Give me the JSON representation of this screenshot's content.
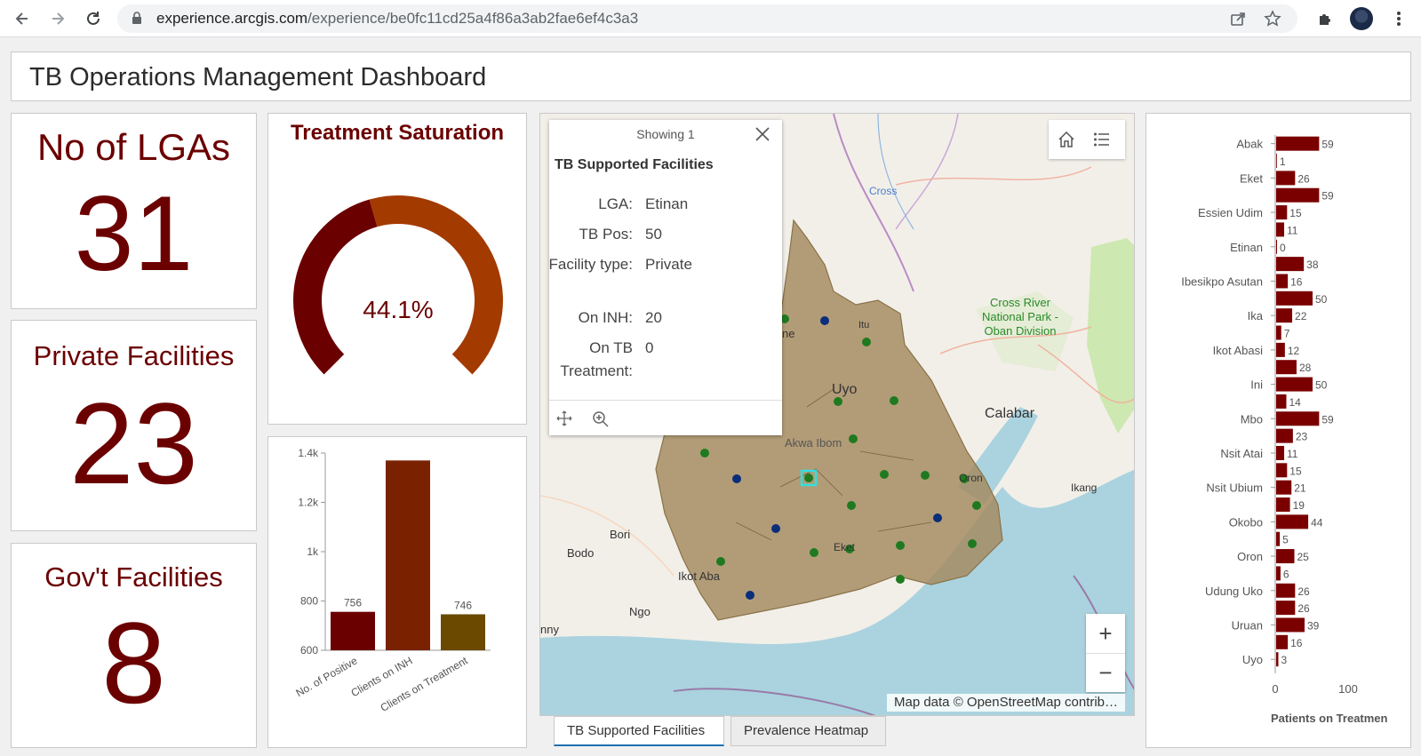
{
  "browser": {
    "url_host": "experience.arcgis.com",
    "url_path": "/experience/be0fc11cd25a4f86a3ab2fae6ef4c3a3"
  },
  "dashboard": {
    "title": "TB Operations Management Dashboard"
  },
  "indicators": [
    {
      "title": "No of LGAs",
      "value": "31"
    },
    {
      "title": "Private Facilities",
      "value": "23"
    },
    {
      "title": "Gov't Facilities",
      "value": "8"
    }
  ],
  "gauge": {
    "title": "Treatment Saturation",
    "value_text": "44.1%",
    "fraction": 0.441,
    "colors": {
      "filled": "#6b0000",
      "remaining": "#a33a00"
    }
  },
  "map": {
    "popup": {
      "header": "Showing 1",
      "title": "TB Supported Facilities",
      "rows": [
        {
          "key": "LGA:",
          "value": "Etinan"
        },
        {
          "key": "TB Pos:",
          "value": "50"
        },
        {
          "key": "Facility type:",
          "value": "Private"
        },
        {
          "key": "On INH:",
          "value": "20"
        },
        {
          "key": "On TB Treatment:",
          "value": "0"
        }
      ]
    },
    "labels": {
      "cross": "Cross",
      "park": "Cross River National Park - Oban Division",
      "uyo": "Uyo",
      "calabar": "Calabar",
      "akwa_ibom": "Akwa Ibom",
      "itu": "Itu",
      "ikang": "Ikang",
      "oron": "Oron",
      "eket": "Eket",
      "bori": "Bori",
      "bodo": "Bodo",
      "ikot_abasi": "Ikot Aba",
      "ngo": "Ngo",
      "ne": "ne",
      "nny": "nny"
    },
    "attribution": "Map data © OpenStreetMap contrib…",
    "zoom_in": "+",
    "zoom_out": "−"
  },
  "tabs": [
    "TB Supported Facilities",
    "Prevalence Heatmap"
  ],
  "chart_data": [
    {
      "type": "bar",
      "categories": [
        "No. of Positive",
        "Clients on INH",
        "Clients on Treatment"
      ],
      "values": [
        756,
        1370,
        746
      ],
      "data_labels": [
        "756",
        "",
        "746"
      ],
      "colors": [
        "#6b0000",
        "#7a2200",
        "#6b4a00"
      ],
      "ylim": [
        600,
        1400
      ],
      "yticks": [
        600,
        800,
        1000,
        1200,
        1400
      ],
      "ytick_labels": [
        "600",
        "800",
        "1k",
        "1.2k",
        "1.4k"
      ],
      "grid": false,
      "title": "",
      "xlabel": "",
      "ylabel": ""
    },
    {
      "type": "bar",
      "orientation": "horizontal",
      "categories": [
        "Abak",
        "",
        "Eket",
        "",
        "Essien Udim",
        "",
        "Etinan",
        "",
        "Ibesikpo Asutan",
        "",
        "Ika",
        "",
        "Ikot Abasi",
        "",
        "Ini",
        "",
        "Mbo",
        "",
        "Nsit Atai",
        "",
        "Nsit Ubium",
        "",
        "Okobo",
        "",
        "Oron",
        "",
        "Udung Uko",
        "",
        "Uruan",
        "",
        "Uyo"
      ],
      "values": [
        59,
        1,
        26,
        59,
        15,
        11,
        0,
        38,
        16,
        50,
        22,
        7,
        12,
        28,
        50,
        14,
        59,
        23,
        11,
        15,
        21,
        19,
        44,
        5,
        25,
        6,
        26,
        26,
        39,
        16,
        3
      ],
      "xlim": [
        0,
        100
      ],
      "xticks": [
        0,
        100
      ],
      "xlabel": "Patients on Treatmen",
      "color": "#7a0000",
      "title": "",
      "ylabel": ""
    }
  ]
}
